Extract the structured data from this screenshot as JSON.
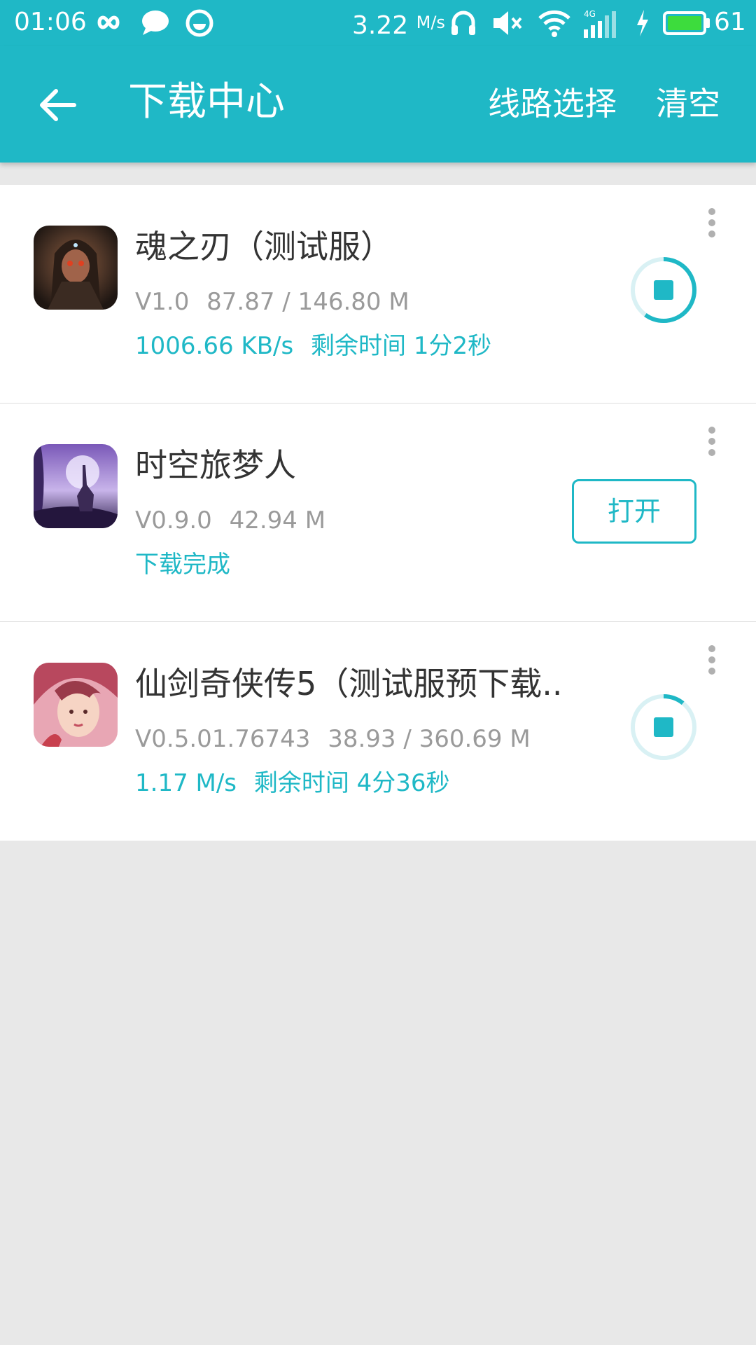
{
  "status_bar": {
    "time": "01:06",
    "net_speed": "3.22",
    "net_speed_unit": "M/s",
    "battery_level": "61",
    "icons": [
      "infinity-icon",
      "chat-bubble-icon",
      "smiley-icon",
      "headphones-icon",
      "mute-icon",
      "wifi-icon",
      "signal-4g-icon",
      "charging-icon",
      "battery-icon"
    ],
    "battery_color": "#3ddc3d"
  },
  "app_bar": {
    "title": "下载中心",
    "route_select_label": "线路选择",
    "clear_label": "清空",
    "background_color": "#1fb8c6"
  },
  "downloads": [
    {
      "name": "魂之刃（测试服）",
      "version": "V1.0",
      "size": "87.87 / 146.80 M",
      "speed": "1006.66 KB/s",
      "remaining": "剩余时间 1分2秒",
      "state": "downloading",
      "progress": 0.6
    },
    {
      "name": "时空旅梦人",
      "version": "V0.9.0",
      "size": "42.94 M",
      "status_text": "下载完成",
      "state": "completed",
      "open_label": "打开"
    },
    {
      "name": "仙剑奇侠传5（测试服预下载..",
      "version": "V0.5.01.76743",
      "size": "38.93 / 360.69 M",
      "speed": "1.17 M/s",
      "remaining": "剩余时间 4分36秒",
      "state": "downloading",
      "progress": 0.108
    }
  ]
}
